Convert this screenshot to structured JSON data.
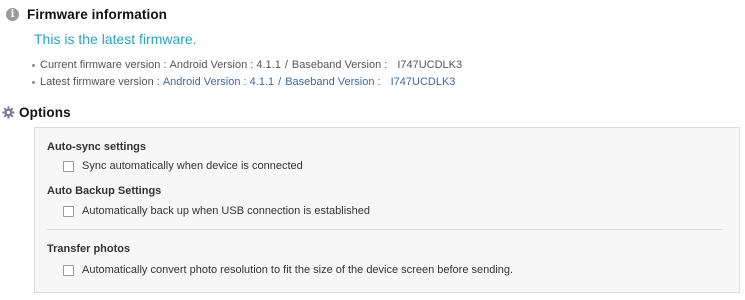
{
  "firmware": {
    "title": "Firmware information",
    "status_message": "This is the latest firmware.",
    "current": {
      "label": "Current firmware version :",
      "android": "Android Version : 4.1.1",
      "separator": "/",
      "baseband": "Baseband Version :",
      "build": "I747UCDLK3"
    },
    "latest": {
      "label": "Latest firmware version :",
      "android": "Android Version : 4.1.1",
      "separator": "/",
      "baseband": "Baseband Version :",
      "build": "I747UCDLK3"
    },
    "link_color": "#3c68a9",
    "status_color": "#22a8c4"
  },
  "options": {
    "title": "Options",
    "auto_sync": {
      "title": "Auto-sync settings",
      "checkbox_label": "Sync automatically when device is connected",
      "checked": false
    },
    "auto_backup": {
      "title": "Auto Backup Settings",
      "checkbox_label": "Automatically back up when USB connection is established",
      "checked": false
    },
    "transfer_photos": {
      "title": "Transfer photos",
      "checkbox_label": "Automatically convert photo resolution to fit the size of the device screen before sending.",
      "checked": false
    }
  },
  "icons": {
    "firmware": "info-icon",
    "options": "gear-icon"
  }
}
